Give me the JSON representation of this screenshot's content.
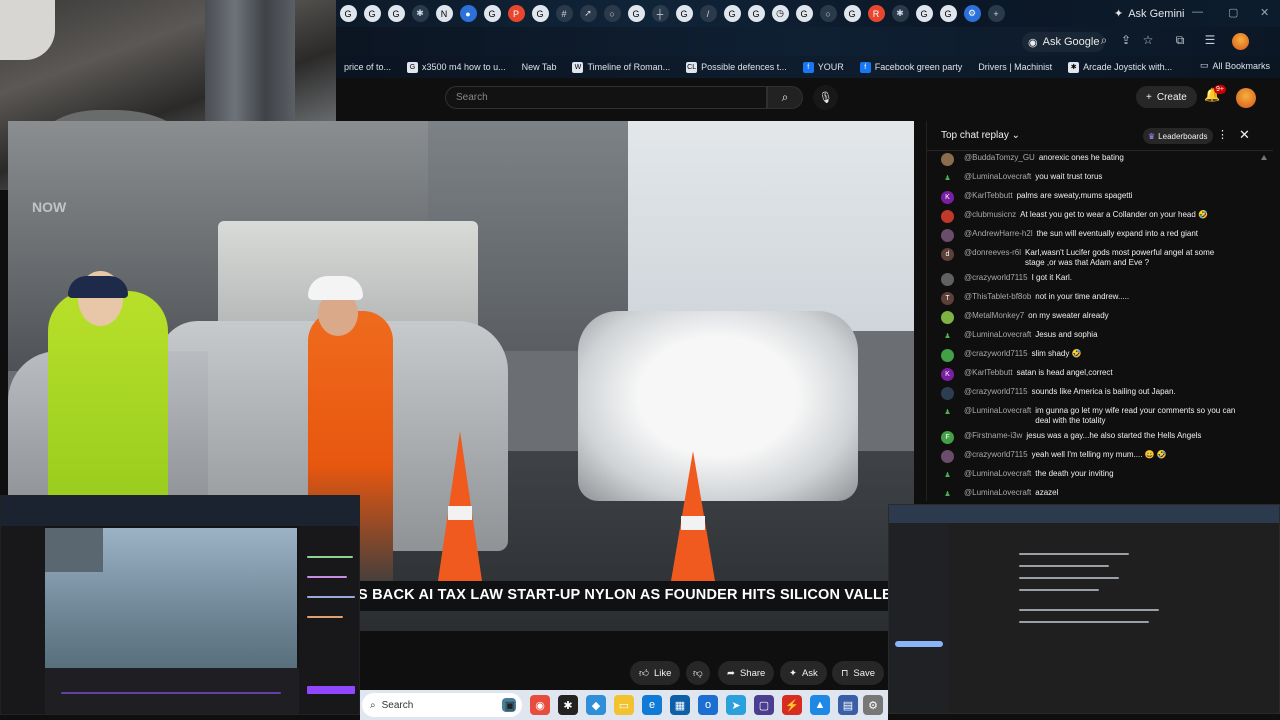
{
  "browser": {
    "ask_gemini": "Ask Gemini",
    "ask_google": "Ask Google",
    "bookmarks": [
      "price of to...",
      "x3500 m4 how to u...",
      "New Tab",
      "Timeline of Roman...",
      "Possible defences t...",
      "YOUR",
      "Facebook green party",
      "Drivers | Machinist",
      "Arcade Joystick with..."
    ],
    "all_bookmarks": "All Bookmarks"
  },
  "youtube": {
    "search_placeholder": "Search",
    "create_label": "Create",
    "notification_count": "9+",
    "video": {
      "ticker": "S BACK AI TAX LAW START-UP NYLON AS FOUNDER HITS SILICON VALLE",
      "bug": "NOW"
    },
    "actions": {
      "like": "Like",
      "share": "Share",
      "ask": "Ask",
      "save": "Save"
    },
    "chat": {
      "title": "Top chat replay",
      "leaderboards": "Leaderboards",
      "messages": [
        {
          "author": "@BuddaTomzy_GU",
          "text": "anorexic ones he bating",
          "avatar": "photo"
        },
        {
          "author": "@LuminaLovecraft",
          "text": "you wait trust torus",
          "avatar": "icon"
        },
        {
          "author": "@KarlTebbutt",
          "text": "palms are sweaty,mums spagetti",
          "avatar": "K"
        },
        {
          "author": "@clubmusicnz",
          "text": "At least you get to wear a Collander on your head 🤣",
          "avatar": "photo"
        },
        {
          "author": "@AndrewHarre-h2l",
          "text": "the sun will eventually expand into a red giant",
          "avatar": "photo"
        },
        {
          "author": "@donreeves-r6l",
          "text": "Karl,wasn't Lucifer gods most powerful angel at some stage ,or was that Adam and Eve ?",
          "avatar": "d"
        },
        {
          "author": "@crazyworld7115",
          "text": "I got it Karl.",
          "avatar": "photo"
        },
        {
          "author": "@ThisTablet-bf8ob",
          "text": "not in your time andrew.....",
          "avatar": "T"
        },
        {
          "author": "@MetalMonkey7",
          "text": "on my sweater already",
          "avatar": "photo"
        },
        {
          "author": "@LuminaLovecraft",
          "text": "Jesus and sophia",
          "avatar": "icon"
        },
        {
          "author": "@crazyworld7115",
          "text": "slim shady 🤣",
          "avatar": "photo"
        },
        {
          "author": "@KarlTebbutt",
          "text": "satan is head angel,correct",
          "avatar": "K"
        },
        {
          "author": "@crazyworld7115",
          "text": "sounds like America is bailing out Japan.",
          "avatar": "photo"
        },
        {
          "author": "@LuminaLovecraft",
          "text": "im gunna go let my wife read your comments so you can deal with the totality",
          "avatar": "icon"
        },
        {
          "author": "@Firstname-i3w",
          "text": "jesus was a gay...he also started the Hells Angels",
          "avatar": "F"
        },
        {
          "author": "@crazyworld7115",
          "text": "yeah well I'm telling my mum.... 😀 🤣",
          "avatar": "photo"
        },
        {
          "author": "@LuminaLovecraft",
          "text": "the death your inviting",
          "avatar": "icon"
        },
        {
          "author": "@LuminaLovecraft",
          "text": "azazel",
          "avatar": "icon"
        }
      ]
    }
  },
  "taskbar": {
    "search_label": "Search"
  },
  "colors": {
    "background": "#0f0f0f",
    "accent_red": "#cc0000",
    "hiviz_yellow": "#b8e02a",
    "hiviz_orange": "#ef6b1d"
  }
}
